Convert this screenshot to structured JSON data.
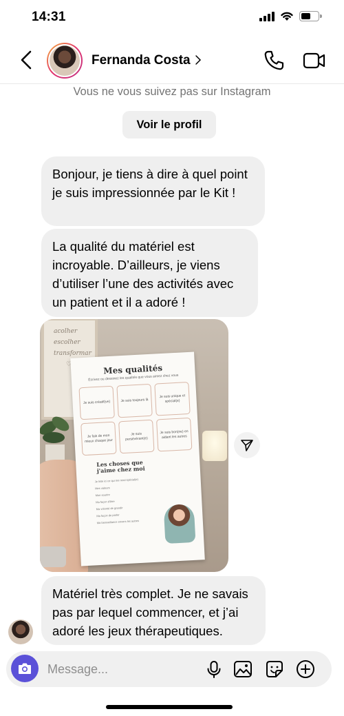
{
  "status_bar": {
    "time": "14:31",
    "battery_level": 0.6
  },
  "header": {
    "contact_name": "Fernanda Costa"
  },
  "notice": {
    "text": "Vous ne vous suivez pas sur Instagram",
    "profile_button": "Voir le profil"
  },
  "messages": [
    {
      "text": "Bonjour, je tiens à dire à quel point je suis impressionnée par le Kit !"
    },
    {
      "text": "La qualité du matériel est incroyable. D’ailleurs, je viens d’utiliser l’une des activités avec un patient et il a adoré !"
    },
    {
      "type": "photo",
      "wall_sign": [
        "acolher",
        "escolher",
        "transformar"
      ],
      "sheet": {
        "title": "Mes qualités",
        "subtitle": "Écrivez ou dessinez les qualités que vous aimez chez vous",
        "cells": [
          "Je suis créatif(ve)",
          "Je suis toujours là",
          "Je suis unique et spécial(e)",
          "Je fais de mon mieux chaque jour",
          "Je suis persévérant(e)",
          "Je suis bon(ne) en aidant les autres"
        ],
        "section_title": "Les choses que j'aime chez moi",
        "section_intro": "Je liste ici ce qui me rend spécial(e)",
        "items": [
          "Mes valeurs",
          "Mon sourire",
          "Ma façon d'être",
          "Ma volonté de grandir",
          "Ma façon de parler",
          "Ma bienveillance envers les autres"
        ]
      }
    },
    {
      "text": "Matériel très complet. Je ne savais pas par lequel commencer, et j’ai adoré les jeux thérapeutiques."
    }
  ],
  "composer": {
    "placeholder": "Message..."
  },
  "icons": {
    "back": "chevron-left-icon",
    "call": "phone-icon",
    "video": "video-camera-icon",
    "share": "send-icon",
    "camera": "camera-icon",
    "mic": "microphone-icon",
    "gallery": "image-icon",
    "sticker": "sticker-icon",
    "plus": "plus-circle-icon"
  },
  "colors": {
    "camera_button": "#5b51d8",
    "bubble": "#efefef",
    "muted_text": "#737373"
  }
}
